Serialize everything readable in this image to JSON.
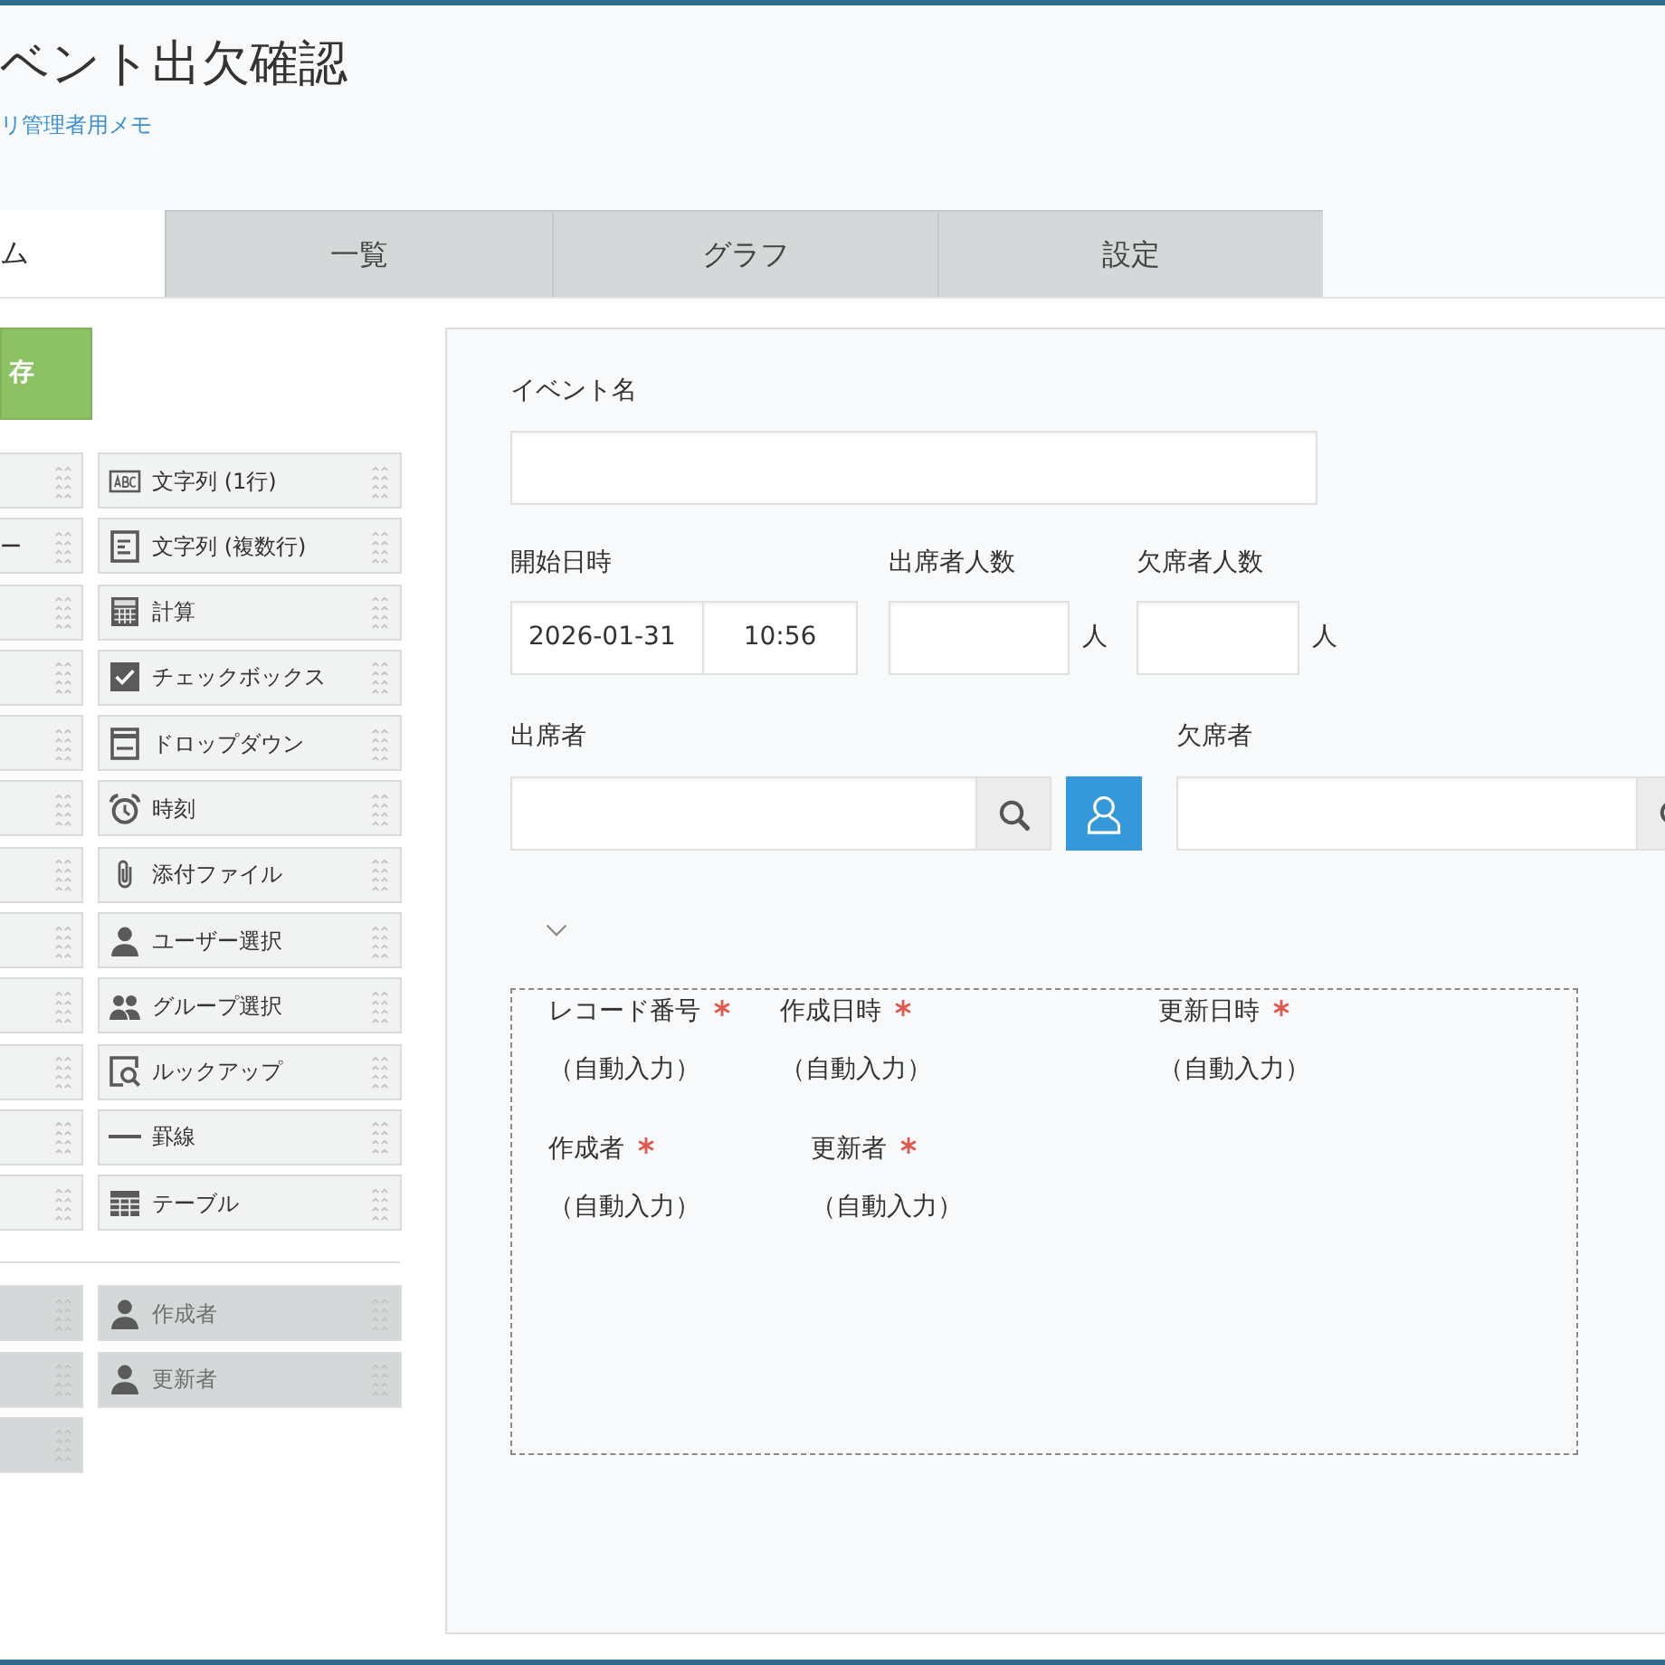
{
  "header": {
    "title": "ベント出欠確認",
    "memo_link": "リ管理者用メモ"
  },
  "tabs": [
    {
      "label": "ム",
      "selected": true
    },
    {
      "label": "一覧",
      "selected": false
    },
    {
      "label": "グラフ",
      "selected": false
    },
    {
      "label": "設定",
      "selected": false
    }
  ],
  "palette": {
    "save_button": {
      "label": "存"
    },
    "column_1": [
      {
        "kind": "field"
      },
      {
        "kind": "field",
        "label": "ー"
      },
      {
        "kind": "field"
      },
      {
        "kind": "field"
      },
      {
        "kind": "field"
      },
      {
        "kind": "field"
      },
      {
        "kind": "field"
      },
      {
        "kind": "field"
      },
      {
        "kind": "field"
      },
      {
        "kind": "field"
      },
      {
        "kind": "field"
      },
      {
        "kind": "field"
      },
      {
        "kind": "system"
      },
      {
        "kind": "system"
      },
      {
        "kind": "system"
      }
    ],
    "column_2": [
      {
        "kind": "text",
        "label": "文字列 (1行)"
      },
      {
        "kind": "multiline",
        "label": "文字列 (複数行)"
      },
      {
        "kind": "calc",
        "label": "計算"
      },
      {
        "kind": "checkbox",
        "label": "チェックボックス"
      },
      {
        "kind": "dropdown",
        "label": "ドロップダウン"
      },
      {
        "kind": "time",
        "label": "時刻"
      },
      {
        "kind": "attachment",
        "label": "添付ファイル"
      },
      {
        "kind": "user",
        "label": "ユーザー選択"
      },
      {
        "kind": "group",
        "label": "グループ選択"
      },
      {
        "kind": "lookup",
        "label": "ルックアップ"
      },
      {
        "kind": "line",
        "label": "罫線"
      },
      {
        "kind": "table",
        "label": "テーブル"
      },
      {
        "kind": "creator",
        "label": "作成者"
      },
      {
        "kind": "modifier",
        "label": "更新者"
      }
    ]
  },
  "form": {
    "event_name": {
      "label": "イベント名"
    },
    "start": {
      "label": "開始日時",
      "date": "2026-01-31",
      "time": "10:56"
    },
    "attendee_count": {
      "label": "出席者人数",
      "unit": "人"
    },
    "absentee_count": {
      "label": "欠席者人数",
      "unit": "人"
    },
    "attendees": {
      "label": "出席者"
    },
    "absentees": {
      "label": "欠席者"
    },
    "auto_field_rows": [
      [
        {
          "label": "レコード番号",
          "required": true,
          "value": "（自動入力）"
        },
        {
          "label": "作成日時",
          "required": true,
          "value": "（自動入力）"
        },
        {
          "label": "更新日時",
          "required": true,
          "value": "（自動入力）"
        }
      ],
      [
        {
          "label": "作成者",
          "required": true,
          "value": "（自動入力）"
        },
        {
          "label": "更新者",
          "required": true,
          "value": "（自動入力）"
        }
      ]
    ]
  }
}
